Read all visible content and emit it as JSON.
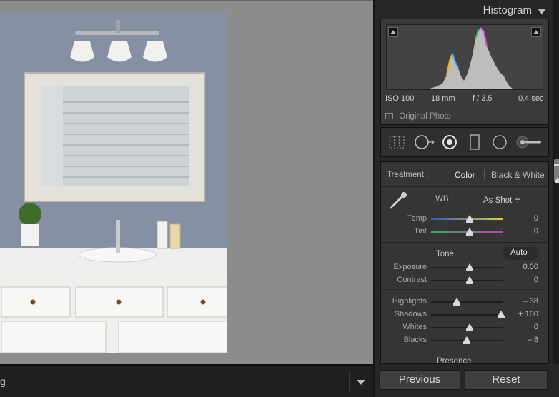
{
  "canvas": {
    "filmstrip_label": "g"
  },
  "histogram": {
    "title": "Histogram",
    "meta": {
      "iso": "ISO 100",
      "focal": "18 mm",
      "aperture": "f / 3.5",
      "shutter": "0.4 sec"
    },
    "original_photo_label": "Original Photo"
  },
  "tools": {
    "items": [
      "crop-overlay",
      "spot-removal",
      "red-eye",
      "graduated-filter",
      "radial-filter",
      "adjustment-brush"
    ]
  },
  "basic": {
    "treatment_label": "Treatment :",
    "treatment_color": "Color",
    "treatment_bw": "Black & White",
    "wb_label": "WB :",
    "wb_value": "As Shot ≑",
    "temp_label": "Temp",
    "temp_value": "0",
    "tint_label": "Tint",
    "tint_value": "0",
    "tone_label": "Tone",
    "auto_label": "Auto",
    "exposure_label": "Exposure",
    "exposure_value": "0.00",
    "contrast_label": "Contrast",
    "contrast_value": "0",
    "highlights_label": "Highlights",
    "highlights_value": "– 38",
    "shadows_label": "Shadows",
    "shadows_value": "+ 100",
    "whites_label": "Whites",
    "whites_value": "0",
    "blacks_label": "Blacks",
    "blacks_value": "– 8",
    "presence_label": "Presence"
  },
  "buttons": {
    "previous": "Previous",
    "reset": "Reset"
  },
  "colors": {
    "panel_bg": "#262626",
    "canvas_bg": "#8c8c8c",
    "temp_gradient": [
      "#2f56c9",
      "#d6d43a"
    ],
    "tint_gradient": [
      "#2bb24c",
      "#c23bbd"
    ]
  }
}
